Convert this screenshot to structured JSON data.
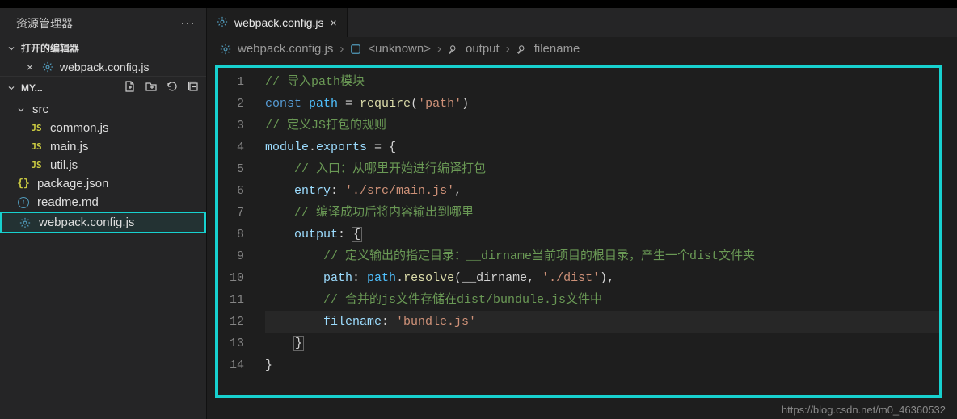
{
  "sidebar": {
    "title": "资源管理器",
    "open_editors_label": "打开的编辑器",
    "open_editors": [
      {
        "name": "webpack.config.js"
      }
    ],
    "folder_name": "MY...",
    "tree": [
      {
        "kind": "folder-open",
        "name": "src",
        "depth": 0
      },
      {
        "kind": "js",
        "name": "common.js",
        "depth": 1
      },
      {
        "kind": "js",
        "name": "main.js",
        "depth": 1
      },
      {
        "kind": "js",
        "name": "util.js",
        "depth": 1
      },
      {
        "kind": "json",
        "name": "package.json",
        "depth": 0
      },
      {
        "kind": "md",
        "name": "readme.md",
        "depth": 0
      },
      {
        "kind": "gear",
        "name": "webpack.config.js",
        "depth": 0,
        "selected": true
      }
    ]
  },
  "tabs": [
    {
      "name": "webpack.config.js",
      "active": true
    }
  ],
  "breadcrumbs": {
    "file": "webpack.config.js",
    "segments": [
      "<unknown>",
      "output",
      "filename"
    ]
  },
  "code": {
    "lines": 14,
    "raw": [
      "// 导入path模块",
      "const path = require('path')",
      "// 定义JS打包的规则",
      "module.exports = {",
      "    // 入口：从哪里开始进行编译打包",
      "    entry: './src/main.js',",
      "    // 编译成功后将内容输出到哪里",
      "    output: {",
      "        // 定义输出的指定目录：__dirname当前项目的根目录，产生一个dist文件夹",
      "        path: path.resolve(__dirname, './dist'),",
      "        // 合并的js文件存储在dist/bundule.js文件中",
      "        filename: 'bundle.js'",
      "    }",
      "}"
    ],
    "highlight_line": 12,
    "tokens": [
      [
        {
          "t": "comment",
          "v": "// 导入path模块"
        }
      ],
      [
        {
          "t": "kw",
          "v": "const "
        },
        {
          "t": "var",
          "v": "path"
        },
        {
          "t": "punc",
          "v": " = "
        },
        {
          "t": "fn",
          "v": "require"
        },
        {
          "t": "punc",
          "v": "("
        },
        {
          "t": "str",
          "v": "'path'"
        },
        {
          "t": "punc",
          "v": ")"
        }
      ],
      [
        {
          "t": "comment",
          "v": "// 定义JS打包的规则"
        }
      ],
      [
        {
          "t": "builtin",
          "v": "module"
        },
        {
          "t": "punc",
          "v": "."
        },
        {
          "t": "builtin",
          "v": "exports"
        },
        {
          "t": "punc",
          "v": " = {"
        }
      ],
      [
        {
          "t": "pad",
          "v": "    "
        },
        {
          "t": "comment",
          "v": "// 入口：从哪里开始进行编译打包"
        }
      ],
      [
        {
          "t": "pad",
          "v": "    "
        },
        {
          "t": "prop",
          "v": "entry"
        },
        {
          "t": "punc",
          "v": ": "
        },
        {
          "t": "str",
          "v": "'./src/main.js'"
        },
        {
          "t": "punc",
          "v": ","
        }
      ],
      [
        {
          "t": "pad",
          "v": "    "
        },
        {
          "t": "comment",
          "v": "// 编译成功后将内容输出到哪里"
        }
      ],
      [
        {
          "t": "pad",
          "v": "    "
        },
        {
          "t": "prop",
          "v": "output"
        },
        {
          "t": "punc",
          "v": ": "
        },
        {
          "t": "box",
          "v": "{"
        }
      ],
      [
        {
          "t": "pad",
          "v": "        "
        },
        {
          "t": "comment",
          "v": "// 定义输出的指定目录：__dirname当前项目的根目录，产生一个dist文件夹"
        }
      ],
      [
        {
          "t": "pad",
          "v": "        "
        },
        {
          "t": "prop",
          "v": "path"
        },
        {
          "t": "punc",
          "v": ": "
        },
        {
          "t": "var",
          "v": "path"
        },
        {
          "t": "punc",
          "v": "."
        },
        {
          "t": "fn",
          "v": "resolve"
        },
        {
          "t": "punc",
          "v": "(__dirname, "
        },
        {
          "t": "str",
          "v": "'./dist'"
        },
        {
          "t": "punc",
          "v": "),"
        }
      ],
      [
        {
          "t": "pad",
          "v": "        "
        },
        {
          "t": "comment",
          "v": "// 合并的js文件存储在dist/bundule.js文件中"
        }
      ],
      [
        {
          "t": "pad",
          "v": "        "
        },
        {
          "t": "prop",
          "v": "filename"
        },
        {
          "t": "punc",
          "v": ": "
        },
        {
          "t": "str",
          "v": "'bundle.js'"
        }
      ],
      [
        {
          "t": "pad",
          "v": "    "
        },
        {
          "t": "box",
          "v": "}"
        }
      ],
      [
        {
          "t": "punc",
          "v": "}"
        }
      ]
    ]
  },
  "watermark": "https://blog.csdn.net/m0_46360532"
}
